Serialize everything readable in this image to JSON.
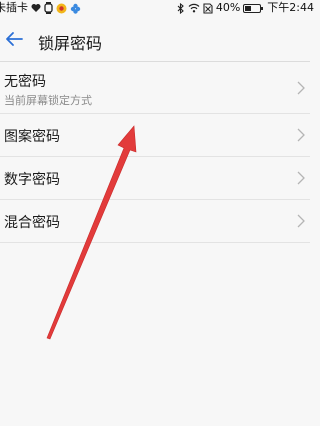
{
  "status_bar": {
    "carrier_text": "未插卡",
    "battery_text": "40%",
    "battery_level": 0.4,
    "time": "下午2:44"
  },
  "header": {
    "title": "锁屏密码"
  },
  "list": {
    "items": [
      {
        "label": "无密码",
        "sublabel": "当前屏幕锁定方式"
      },
      {
        "label": "图案密码"
      },
      {
        "label": "数字密码"
      },
      {
        "label": "混合密码"
      }
    ]
  },
  "colors": {
    "accent": "#2b6fd6",
    "annotation_arrow": "#e23b3b"
  }
}
